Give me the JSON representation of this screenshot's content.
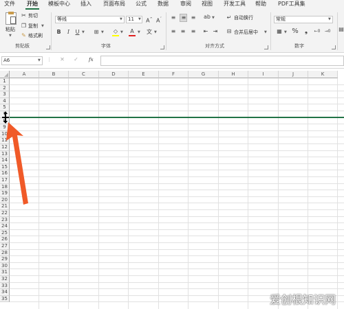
{
  "tabs": [
    {
      "label": "文件",
      "active": false
    },
    {
      "label": "开始",
      "active": true
    },
    {
      "label": "模板中心",
      "active": false
    },
    {
      "label": "插入",
      "active": false
    },
    {
      "label": "页面布局",
      "active": false
    },
    {
      "label": "公式",
      "active": false
    },
    {
      "label": "数据",
      "active": false
    },
    {
      "label": "审阅",
      "active": false
    },
    {
      "label": "视图",
      "active": false
    },
    {
      "label": "开发工具",
      "active": false
    },
    {
      "label": "帮助",
      "active": false
    },
    {
      "label": "PDF工具集",
      "active": false
    }
  ],
  "clipboard": {
    "paste_label": "粘贴",
    "cut_label": "剪切",
    "copy_label": "复制",
    "format_painter_label": "格式刷",
    "group_label": "剪贴板"
  },
  "font": {
    "font_name": "等线",
    "font_size": "11",
    "group_label": "字体"
  },
  "alignment": {
    "wrap_text_label": "自动换行",
    "merge_center_label": "合并后居中",
    "group_label": "对齐方式"
  },
  "number": {
    "format_value": "常规",
    "group_label": "数字"
  },
  "formula_bar": {
    "name_box_value": "A6",
    "fx_label": "fx",
    "formula_value": ""
  },
  "grid": {
    "columns": [
      "A",
      "B",
      "C",
      "D",
      "E",
      "F",
      "G",
      "H",
      "I",
      "J",
      "K"
    ],
    "rows": [
      "1",
      "2",
      "3",
      "4",
      "5",
      "7",
      "8",
      "9",
      "10",
      "11",
      "12",
      "13",
      "14",
      "15",
      "16",
      "17",
      "18",
      "19",
      "20",
      "21",
      "22",
      "23",
      "24",
      "25",
      "26",
      "27",
      "28",
      "29",
      "30",
      "31",
      "32",
      "33",
      "34",
      "35"
    ],
    "hidden_row": "6"
  },
  "annotation": {
    "arrow_color": "#f05a28",
    "divider_color": "#217346"
  },
  "watermark": {
    "text": "爱创根知识网"
  }
}
